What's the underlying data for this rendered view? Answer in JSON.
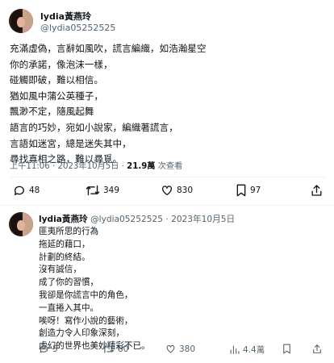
{
  "main_post": {
    "display_name": "lydia黃燕玲",
    "handle": "@lydia05252525",
    "lines": [
      "充滿虛偽，言辭如風吹，謊言編織，如浩瀚星空",
      "你的承諾，像泡沫一樣，",
      "碰觸即破，難以相信。",
      "猶如風中蒲公英種子，",
      "飄渺不定，隨風起舞",
      "語言的巧妙，宛如小說家，編織著謊言，",
      "言語如迷宮，總是迷失其中，",
      "尋找真相之路，難以尋覓。"
    ],
    "time": "上午11:06",
    "date": "2023年10月5日",
    "views_count": "21.9萬",
    "views_label": "次查看",
    "actions": {
      "replies": "48",
      "retweets": "349",
      "likes": "830",
      "bookmarks": "97"
    }
  },
  "reply_post": {
    "display_name": "lydia黃燕玲",
    "handle": "@lydia05252525",
    "date": "2023年10月5日",
    "lines": [
      "匪夷所思的行為",
      "拖延的藉口，",
      "計劃的終結。",
      "沒有誠信，",
      "成了你的習慣，",
      "我卻是你謊言中的角色，",
      "一直捲入其中。",
      "唉呀！寫作小說的藝術，",
      "創造力令人印象深刻，",
      "虛幻的世界也美妙精彩不已。"
    ],
    "actions": {
      "replies": "5",
      "retweets": "80",
      "likes": "380",
      "views": "4.4萬"
    }
  },
  "separators": {
    "dot": "·"
  }
}
